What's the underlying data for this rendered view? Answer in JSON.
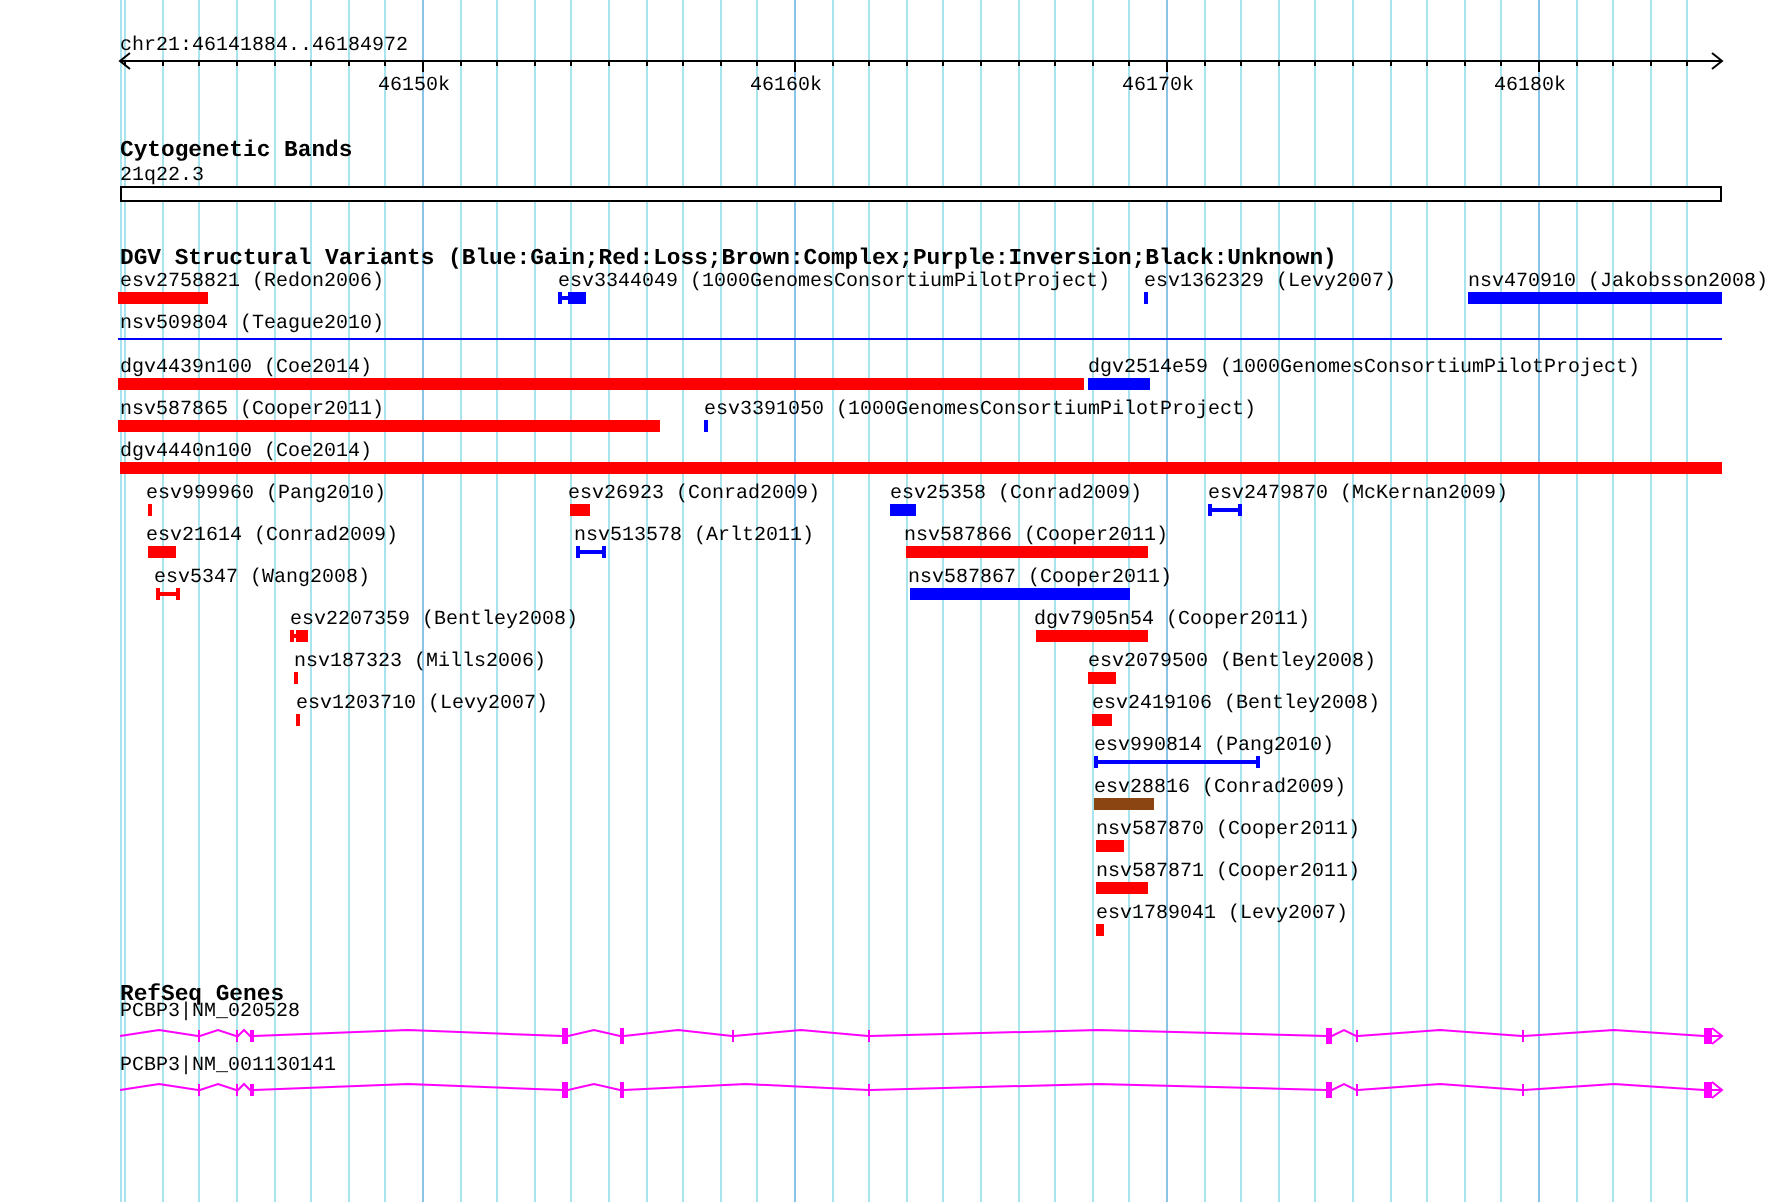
{
  "ruler": {
    "location": "chr21:46141884..46184972",
    "ticks": [
      "46150k",
      "46160k",
      "46170k",
      "46180k"
    ]
  },
  "tracks": [
    {
      "title": "Cytogenetic Bands",
      "kind": "cytoband",
      "features": [
        {
          "label": "21q22.3"
        }
      ]
    },
    {
      "title": "DGV Structural Variants (Blue:Gain;Red:Loss;Brown:Complex;Purple:Inversion;Black:Unknown)",
      "kind": "variants",
      "features": [
        {
          "label": "esv2758821 (Redon2006)",
          "color": "#ff0000"
        },
        {
          "label": "esv3344049 (1000GenomesConsortiumPilotProject)",
          "color": "#0000ff"
        },
        {
          "label": "esv1362329 (Levy2007)",
          "color": "#0000ff"
        },
        {
          "label": "nsv470910 (Jakobsson2008)",
          "color": "#0000ff"
        },
        {
          "label": "nsv509804 (Teague2010)",
          "color": "#0000ff"
        },
        {
          "label": "dgv4439n100 (Coe2014)",
          "color": "#ff0000"
        },
        {
          "label": "dgv2514e59 (1000GenomesConsortiumPilotProject)",
          "color": "#0000ff"
        },
        {
          "label": "nsv587865 (Cooper2011)",
          "color": "#ff0000"
        },
        {
          "label": "esv3391050 (1000GenomesConsortiumPilotProject)",
          "color": "#0000ff"
        },
        {
          "label": "dgv4440n100 (Coe2014)",
          "color": "#ff0000"
        },
        {
          "label": "esv999960 (Pang2010)",
          "color": "#ff0000"
        },
        {
          "label": "esv26923 (Conrad2009)",
          "color": "#ff0000"
        },
        {
          "label": "esv25358 (Conrad2009)",
          "color": "#0000ff"
        },
        {
          "label": "esv2479870 (McKernan2009)",
          "color": "#0000ff"
        },
        {
          "label": "esv21614 (Conrad2009)",
          "color": "#ff0000"
        },
        {
          "label": "nsv513578 (Arlt2011)",
          "color": "#0000ff"
        },
        {
          "label": "nsv587866 (Cooper2011)",
          "color": "#ff0000"
        },
        {
          "label": "esv5347 (Wang2008)",
          "color": "#ff0000"
        },
        {
          "label": "nsv587867 (Cooper2011)",
          "color": "#0000ff"
        },
        {
          "label": "esv2207359 (Bentley2008)",
          "color": "#ff0000"
        },
        {
          "label": "dgv7905n54 (Cooper2011)",
          "color": "#ff0000"
        },
        {
          "label": "nsv187323 (Mills2006)",
          "color": "#ff0000"
        },
        {
          "label": "esv2079500 (Bentley2008)",
          "color": "#ff0000"
        },
        {
          "label": "esv1203710 (Levy2007)",
          "color": "#ff0000"
        },
        {
          "label": "esv2419106 (Bentley2008)",
          "color": "#ff0000"
        },
        {
          "label": "esv990814 (Pang2010)",
          "color": "#0000ff"
        },
        {
          "label": "esv28816 (Conrad2009)",
          "color": "#8b4513"
        },
        {
          "label": "nsv587870 (Cooper2011)",
          "color": "#ff0000"
        },
        {
          "label": "nsv587871 (Cooper2011)",
          "color": "#ff0000"
        },
        {
          "label": "esv1789041 (Levy2007)",
          "color": "#ff0000"
        }
      ]
    },
    {
      "title": "RefSeq Genes",
      "kind": "genes",
      "features": [
        {
          "label": "PCBP3|NM_020528"
        },
        {
          "label": "PCBP3|NM_001130141"
        }
      ]
    }
  ]
}
